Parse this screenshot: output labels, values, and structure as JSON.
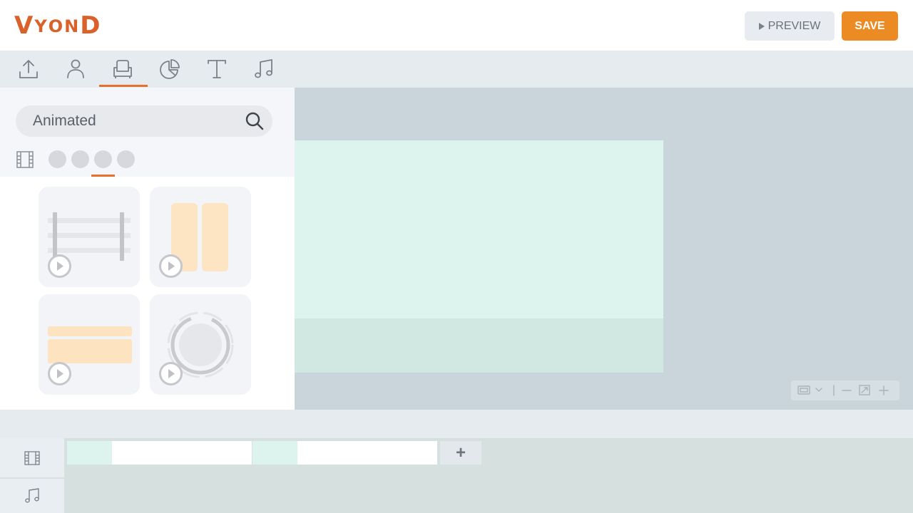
{
  "header": {
    "logo": {
      "letters": [
        "V",
        "Y",
        "O",
        "N",
        "D"
      ],
      "color": "#d9622b"
    },
    "preview_label": "PREVIEW",
    "save_label": "SAVE",
    "save_color": "#ec8a23"
  },
  "toolbar": {
    "tools": [
      {
        "name": "upload",
        "icon": "upload-icon"
      },
      {
        "name": "characters",
        "icon": "person-icon"
      },
      {
        "name": "props",
        "icon": "armchair-icon",
        "active": true
      },
      {
        "name": "charts",
        "icon": "pie-chart-icon"
      },
      {
        "name": "text",
        "icon": "text-icon"
      },
      {
        "name": "audio",
        "icon": "music-note-icon"
      }
    ],
    "accent": "#e8702a"
  },
  "library": {
    "search": {
      "value": "Animated",
      "icon": "search-icon"
    },
    "filters": {
      "selected_index": 2,
      "count": 4
    },
    "cards": [
      {
        "kind": "fence-animation"
      },
      {
        "kind": "twin-bars-animation"
      },
      {
        "kind": "banner-animation"
      },
      {
        "kind": "ring-animation"
      }
    ]
  },
  "stage": {
    "scene_color": "#dcf3ee",
    "background_color": "#c9d5da"
  },
  "timeline": {
    "scenes": [
      {
        "index": 1
      },
      {
        "index": 2
      }
    ],
    "add_label": "+"
  }
}
